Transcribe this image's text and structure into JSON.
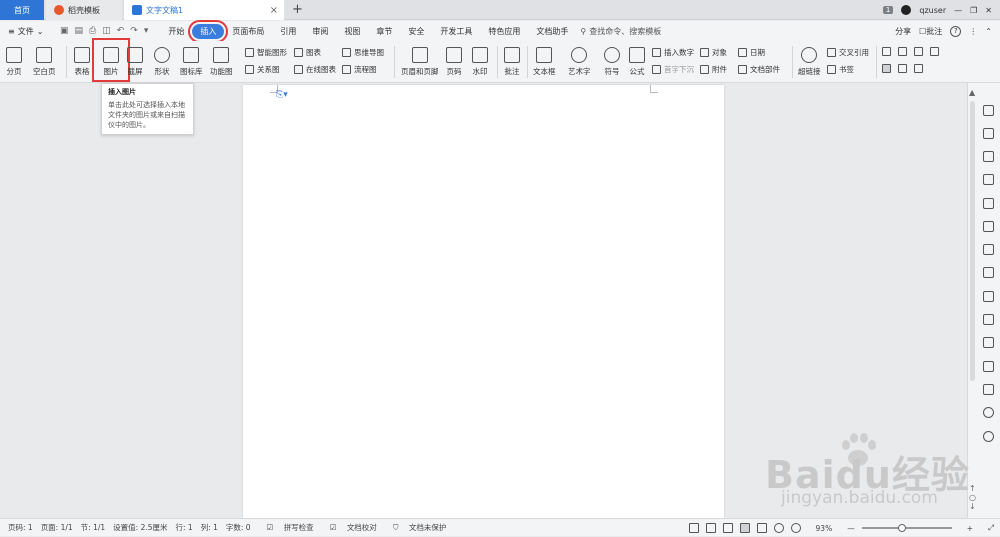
{
  "tabs": {
    "home": "首页",
    "templates": "稻壳模板",
    "doc": "文字文稿1",
    "new_tab": "+",
    "close": "×"
  },
  "titlebar": {
    "badge": "1",
    "user": "qzuser",
    "win_min": "—",
    "win_restore": "❐",
    "win_close": "✕"
  },
  "menubar": {
    "file": "文件",
    "items": [
      "开始",
      "插入",
      "页面布局",
      "引用",
      "审阅",
      "视图",
      "章节",
      "安全",
      "开发工具",
      "特色应用",
      "文档助手"
    ],
    "active": "插入",
    "search": "查找命令、搜索模板",
    "share": "分享",
    "comment": "批注",
    "help": "?"
  },
  "ribbon": {
    "page_break": "分页",
    "blank_page": "空白页",
    "table": "表格",
    "picture": "图片",
    "screenshot": "截屏",
    "shape": "形状",
    "icon_lib": "图标库",
    "function_chart": "功能图",
    "smart_graphic": "智能图形",
    "relation_graph": "关系图",
    "chart": "图表",
    "online_chart": "在线图表",
    "mind_map": "思维导图",
    "flow_chart": "流程图",
    "header_footer": "页眉和页脚",
    "page_num": "页码",
    "watermark": "水印",
    "annotation": "批注",
    "textbox": "文本框",
    "wordart": "艺术字",
    "symbol": "符号",
    "formula": "公式",
    "insert_number": "插入数字",
    "object": "对象",
    "date": "日期",
    "drop_cap": "首字下沉",
    "attachment": "附件",
    "doc_parts": "文档部件",
    "hyperlink": "超链接",
    "cross_ref": "交叉引用",
    "bookmark": "书签"
  },
  "tooltip": {
    "title": "插入图片",
    "body": "单击此处可选择插入本地文件夹的图片或来自扫描仪中的图片。"
  },
  "status": {
    "page_no": "页码: 1",
    "pages": "页面: 1/1",
    "section": "节: 1/1",
    "setting": "设置值: 2.5厘米",
    "row": "行: 1",
    "col": "列: 1",
    "words": "字数: 0",
    "spell": "拼写检查",
    "proof": "文档校对",
    "protect": "文档未保护",
    "zoom": "93%"
  },
  "watermark": {
    "brand": "Baidu经验",
    "url": "jingyan.baidu.com"
  },
  "colors": {
    "accent": "#3b7ddd",
    "highlight": "#e33b3b"
  }
}
